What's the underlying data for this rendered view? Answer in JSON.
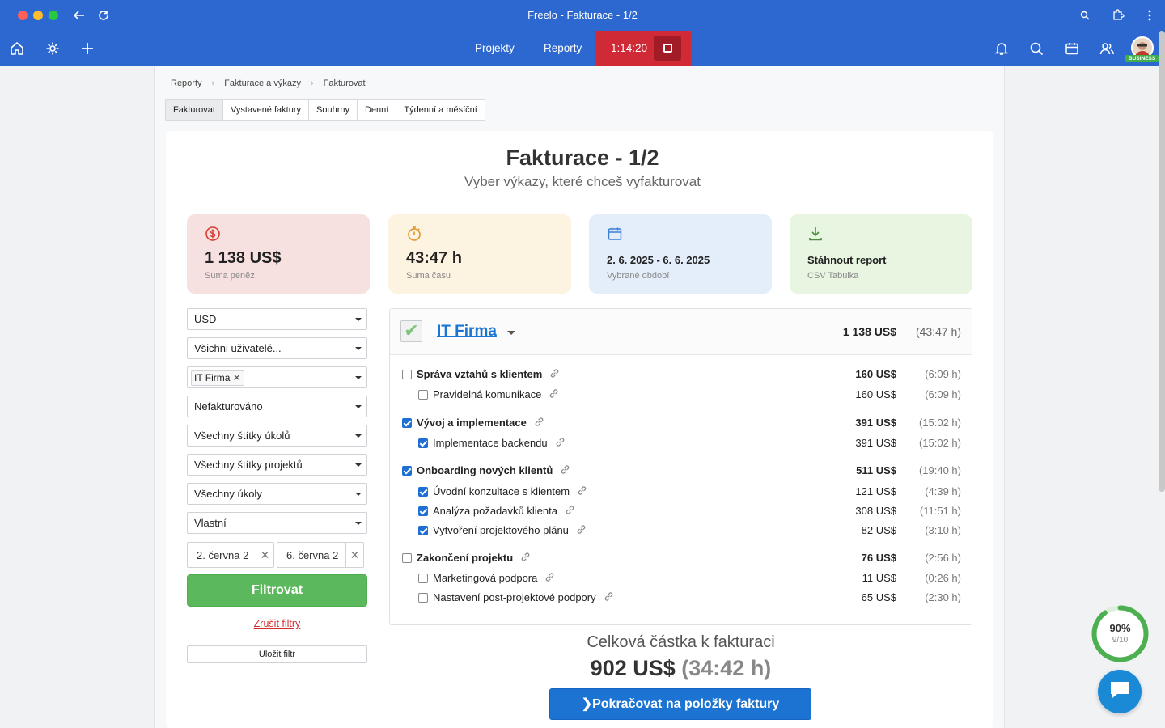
{
  "window": {
    "title": "Freelo - Fakturace - 1/2"
  },
  "nav": {
    "projects": "Projekty",
    "reports": "Reporty",
    "timer": "1:14:20",
    "badge": "BUSINESS"
  },
  "breadcrumbs": [
    "Reporty",
    "Fakturace a výkazy",
    "Fakturovat"
  ],
  "tabs": [
    "Fakturovat",
    "Vystavené faktury",
    "Souhrny",
    "Denní",
    "Týdenní a měsíční"
  ],
  "page": {
    "title": "Fakturace - 1/2",
    "subtitle": "Vyber výkazy, které chceš vyfakturovat"
  },
  "stats": [
    {
      "value": "1 138 US$",
      "label": "Suma peněz",
      "bg": "#f7e1e0",
      "icon": "dollar-circle-icon",
      "color": "#d43a2f"
    },
    {
      "value": "43:47 h",
      "label": "Suma času",
      "bg": "#fdf3e1",
      "icon": "stopwatch-icon",
      "color": "#e0952a"
    },
    {
      "value": "2. 6. 2025 - 6. 6. 2025",
      "label": "Vybrané období",
      "bg": "#e4eefb",
      "icon": "calendar-icon",
      "color": "#3d7fd8"
    },
    {
      "value": "Stáhnout report",
      "label": "CSV Tabulka",
      "bg": "#e8f5e1",
      "icon": "download-icon",
      "color": "#4a8f3a"
    }
  ],
  "filters": {
    "currency": "USD",
    "users": "Všichni uživatelé...",
    "client_tag": "IT Firma",
    "invoiced": "Nefakturováno",
    "task_tags": "Všechny štítky úkolů",
    "project_tags": "Všechny štítky projektů",
    "tasks": "Všechny úkoly",
    "period": "Vlastní",
    "date_from": "2. června 2",
    "date_to": "6. června 2",
    "filter_button": "Filtrovat",
    "clear": "Zrušit filtry",
    "save": "Uložit filtr"
  },
  "firm": {
    "name": "IT Firma",
    "amount": "1 138 US$",
    "time": "(43:47 h)"
  },
  "rows": [
    {
      "name": "Správa vztahů s klientem",
      "amount": "160 US$",
      "time": "(6:09 h)",
      "main": true,
      "checked": false
    },
    {
      "name": "Pravidelná komunikace",
      "amount": "160 US$",
      "time": "(6:09 h)",
      "main": false,
      "checked": false
    },
    {
      "name": "Vývoj a implementace",
      "amount": "391 US$",
      "time": "(15:02 h)",
      "main": true,
      "checked": true
    },
    {
      "name": "Implementace backendu",
      "amount": "391 US$",
      "time": "(15:02 h)",
      "main": false,
      "checked": true
    },
    {
      "name": "Onboarding nových klientů",
      "amount": "511 US$",
      "time": "(19:40 h)",
      "main": true,
      "checked": true
    },
    {
      "name": "Úvodní konzultace s klientem",
      "amount": "121 US$",
      "time": "(4:39 h)",
      "main": false,
      "checked": true
    },
    {
      "name": "Analýza požadavků klienta",
      "amount": "308 US$",
      "time": "(11:51 h)",
      "main": false,
      "checked": true
    },
    {
      "name": "Vytvoření projektového plánu",
      "amount": "82 US$",
      "time": "(3:10 h)",
      "main": false,
      "checked": true
    },
    {
      "name": "Zakončení projektu",
      "amount": "76 US$",
      "time": "(2:56 h)",
      "main": true,
      "checked": false
    },
    {
      "name": "Marketingová podpora",
      "amount": "11 US$",
      "time": "(0:26 h)",
      "main": false,
      "checked": false
    },
    {
      "name": "Nastavení post-projektové podpory",
      "amount": "65 US$",
      "time": "(2:30 h)",
      "main": false,
      "checked": false
    }
  ],
  "total": {
    "label": "Celková částka k fakturaci",
    "amount": "902 US$",
    "time": "(34:42 h)",
    "continue": "Pokračovat na položky faktury"
  },
  "progress": {
    "percent": "90%",
    "count": "9/10",
    "fraction": 0.9
  }
}
